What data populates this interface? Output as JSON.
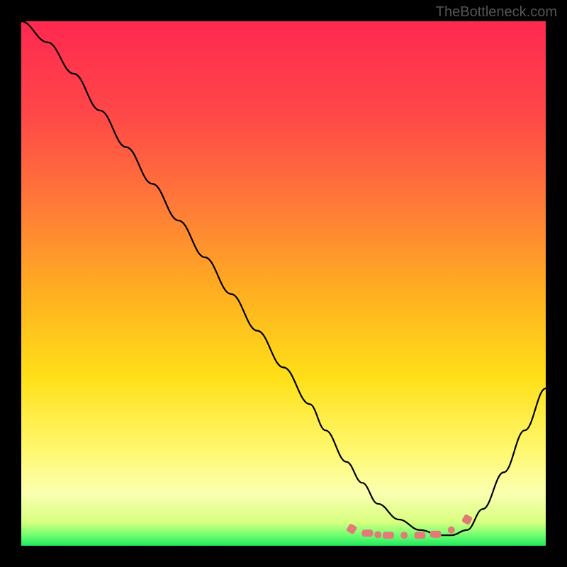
{
  "watermark": "TheBottleneck.com",
  "chart_data": {
    "type": "line",
    "title": "",
    "xlabel": "",
    "ylabel": "",
    "xlim": [
      0,
      100
    ],
    "ylim": [
      0,
      100
    ],
    "series": [
      {
        "name": "curve",
        "color": "#000000",
        "x": [
          0,
          5,
          10,
          15,
          20,
          25,
          30,
          35,
          40,
          45,
          50,
          55,
          58,
          62,
          65,
          68,
          72,
          76,
          80,
          82,
          85,
          88,
          92,
          96,
          100
        ],
        "y": [
          100,
          96,
          90,
          83,
          76,
          69,
          62,
          55,
          48,
          41,
          34,
          27,
          22,
          16,
          12,
          8,
          5,
          3,
          2,
          2,
          3,
          7,
          14,
          22,
          30
        ]
      }
    ],
    "markers": [
      {
        "x": 63,
        "y": 3.2,
        "shape": "rect-rot"
      },
      {
        "x": 66,
        "y": 2.4,
        "shape": "rect"
      },
      {
        "x": 68,
        "y": 2.1,
        "shape": "dot"
      },
      {
        "x": 70,
        "y": 2.0,
        "shape": "rect"
      },
      {
        "x": 73,
        "y": 2.0,
        "shape": "dot"
      },
      {
        "x": 76,
        "y": 2.0,
        "shape": "rect"
      },
      {
        "x": 79,
        "y": 2.2,
        "shape": "rect"
      },
      {
        "x": 82,
        "y": 3.0,
        "shape": "dot"
      },
      {
        "x": 85,
        "y": 5.0,
        "shape": "rect-rot"
      }
    ],
    "gradient_stops": [
      {
        "offset": 0.0,
        "color": "#ff2850"
      },
      {
        "offset": 0.18,
        "color": "#ff4848"
      },
      {
        "offset": 0.35,
        "color": "#ff7a38"
      },
      {
        "offset": 0.52,
        "color": "#ffb020"
      },
      {
        "offset": 0.68,
        "color": "#ffe018"
      },
      {
        "offset": 0.82,
        "color": "#fff870"
      },
      {
        "offset": 0.9,
        "color": "#faffb0"
      },
      {
        "offset": 0.955,
        "color": "#d8ff80"
      },
      {
        "offset": 0.98,
        "color": "#70ff70"
      },
      {
        "offset": 1.0,
        "color": "#20e860"
      }
    ],
    "marker_color": "#e27a78"
  }
}
